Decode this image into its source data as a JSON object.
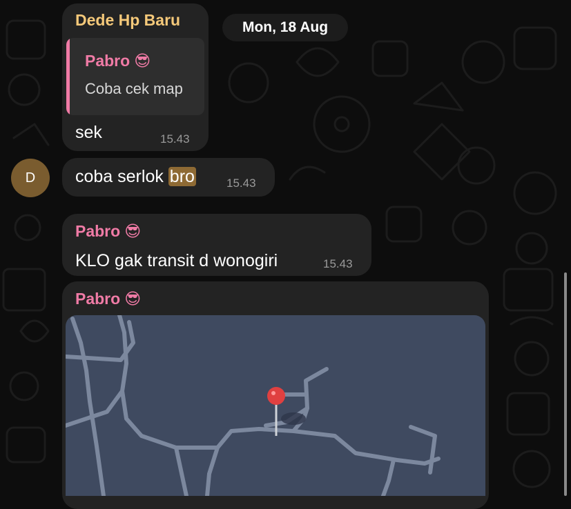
{
  "date_divider": "Mon, 18 Aug",
  "colors": {
    "sender_dede": "#f5c97a",
    "sender_pabro": "#f07ba6",
    "reply_bar": "#f07ba6",
    "bubble_bg": "#232323",
    "map_bg": "#3f4a60",
    "map_road": "#7c889e",
    "pin": "#e04040"
  },
  "messages": [
    {
      "sender": "Dede Hp Baru",
      "reply": {
        "sender": "Pabro",
        "sender_emoji": "😎",
        "text": "Coba cek map"
      },
      "text": "sek",
      "time": "15.43"
    },
    {
      "avatar_initial": "D",
      "text_before": "coba serlok ",
      "text_highlight": "bro",
      "time": "15.43"
    },
    {
      "sender": "Pabro",
      "sender_emoji": "😎",
      "text": "KLO gak transit d wonogiri",
      "time": "15.43"
    },
    {
      "sender": "Pabro",
      "sender_emoji": "😎",
      "attachment": {
        "type": "location-map",
        "icon": "map-pin-icon"
      }
    }
  ]
}
